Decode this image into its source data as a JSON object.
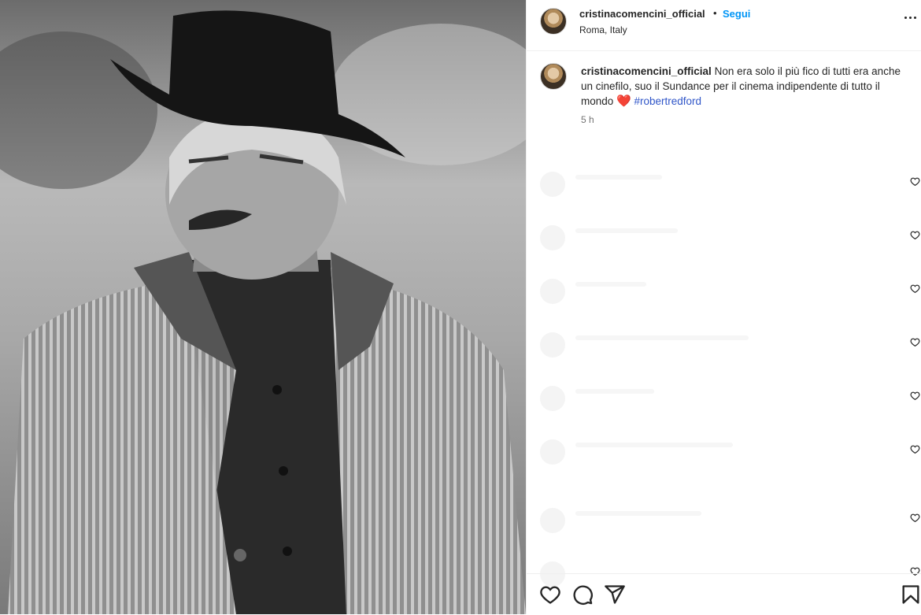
{
  "post": {
    "username": "cristinacomencini_official",
    "separator": "•",
    "follow_label": "Segui",
    "location": "Roma, Italy",
    "more_icon": "more-horizontal-icon"
  },
  "caption": {
    "username": "cristinacomencini_official",
    "text": "Non era solo il più fico di tutti era anche un cinefilo, suo il Sundance per il cinema indipendente di tutto il mondo",
    "emoji": "❤️",
    "hashtag": "#robertredford",
    "timestamp": "5 h"
  },
  "comments": [
    {
      "like_icon": "heart-outline-icon"
    },
    {
      "like_icon": "heart-outline-icon"
    },
    {
      "like_icon": "heart-outline-icon"
    },
    {
      "like_icon": "heart-outline-icon"
    },
    {
      "like_icon": "heart-outline-icon"
    },
    {
      "like_icon": "heart-outline-icon"
    },
    {
      "like_icon": "heart-outline-icon"
    },
    {
      "like_icon": "heart-outline-icon"
    }
  ],
  "actions": {
    "icons": [
      "heart-outline-icon",
      "comment-icon",
      "share-icon",
      "bookmark-icon"
    ]
  },
  "colors": {
    "link": "#0095f6",
    "hashtag": "#2f55c8",
    "heart": "#e0342f",
    "text": "#262626",
    "muted": "#737373"
  }
}
